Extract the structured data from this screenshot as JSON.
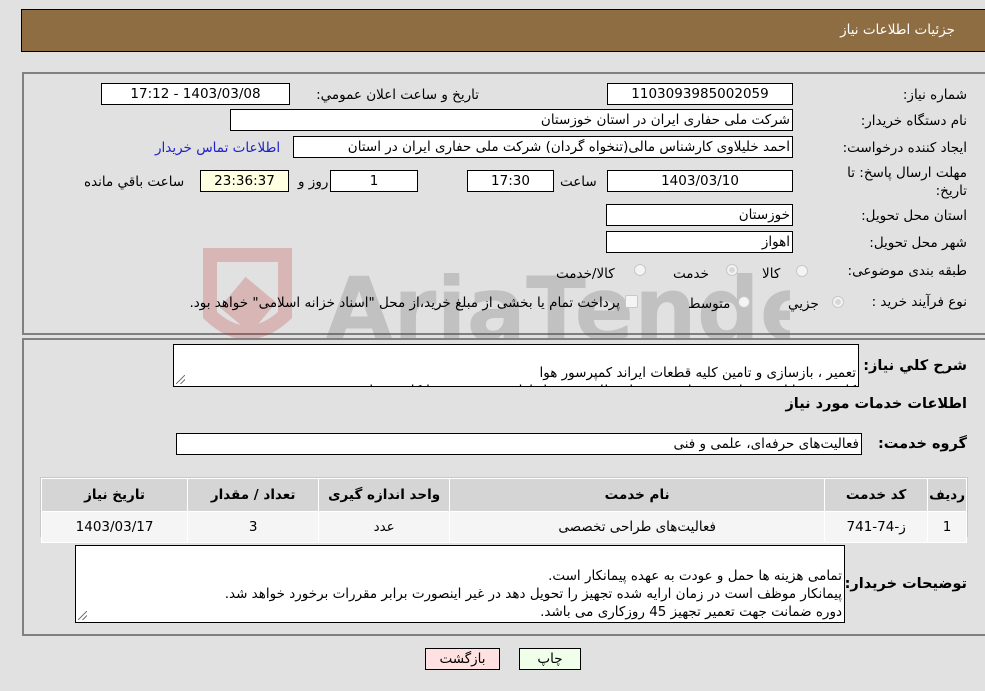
{
  "header": {
    "title": "جزئیات اطلاعات نیاز"
  },
  "watermark": {
    "text": "AriaTender.neT"
  },
  "form": {
    "need_number": {
      "label": "شماره نیاز:",
      "value": "1103093985002059"
    },
    "announce_datetime": {
      "label": "تاریخ و ساعت اعلان عمومي:",
      "value": "1403/03/08 - 17:12"
    },
    "buyer_org": {
      "label": "نام دستگاه خريدار:",
      "value": "شرکت ملی حفاری ایران در استان خوزستان"
    },
    "requester": {
      "label": "ايجاد کننده درخواست:",
      "value": "احمد خلیلاوی کارشناس مالی(تنخواه گردان) شرکت ملی حفاری ایران در استان",
      "contact_link": "اطلاعات تماس خریدار"
    },
    "deadline": {
      "label": "مهلت ارسال پاسخ: تا تاریخ:",
      "date": "1403/03/10",
      "time_label": "ساعت",
      "time": "17:30",
      "days": "1",
      "days_label": "روز و",
      "remaining": "23:36:37",
      "remaining_label": "ساعت باقي مانده"
    },
    "delivery_province": {
      "label": "استان محل تحویل:",
      "value": "خوزستان"
    },
    "delivery_city": {
      "label": "شهر محل تحویل:",
      "value": "اهواز"
    },
    "category": {
      "label": "طبقه بندی موضوعی:",
      "options": [
        {
          "label": "کالا",
          "checked": false
        },
        {
          "label": "خدمت",
          "checked": true
        },
        {
          "label": "کالا/خدمت",
          "checked": false
        }
      ]
    },
    "purchase_type": {
      "label": "نوع فرآیند خرید :",
      "options": [
        {
          "label": "جزيي",
          "checked": true
        },
        {
          "label": "متوسط",
          "checked": false
        }
      ],
      "treasury_note": "پرداخت تمام یا بخشی از مبلغ خرید،از محل \"اسناد خزانه اسلامی\" خواهد بود.",
      "treasury_checked": false
    }
  },
  "description": {
    "label": "شرح کلي نياز:",
    "text": "تعمیر ، بازسازی و تامین کلیه قطعات ایراند کمپرسور هوا\nکلیه هزینه ایاب و ذهاب تجهیزات و پرسنل نظارتی و محل اقامت به عهده پیمانکار می باشد."
  },
  "services": {
    "section_title": "اطلاعات خدمات مورد نياز",
    "group_label": "گروه خدمت:",
    "group_value": "فعالیت‌های حرفه‌ای، علمی و فنی",
    "columns": [
      "رديف",
      "کد خدمت",
      "نام خدمت",
      "واحد اندازه گیری",
      "تعداد / مقدار",
      "تاريخ نياز"
    ],
    "rows": [
      {
        "row": "1",
        "code": "ز-74-741",
        "name": "فعالیت‌های طراحی تخصصی",
        "unit": "عدد",
        "qty": "3",
        "date": "1403/03/17"
      }
    ]
  },
  "buyer_notes": {
    "label": "توضیحات خریدار:",
    "text": "تمامی هزینه ها حمل و عودت به عهده پیمانکار است.\nپیمانکار موظف است در زمان ارایه شده تجهیز را تحویل دهد در غیر اینصورت برابر مقررات برخورد خواهد شد.\nدوره ضمانت جهت تعمیر تجهیز 45 روزکاری می باشد."
  },
  "buttons": {
    "print": "چاپ",
    "back": "بازگشت"
  },
  "colors": {
    "header_bg": "#8e6d42",
    "link": "#2020c8",
    "print_bg": "#efffe9",
    "back_bg": "#ffe1e1",
    "remaining_bg": "#ffffe1"
  }
}
